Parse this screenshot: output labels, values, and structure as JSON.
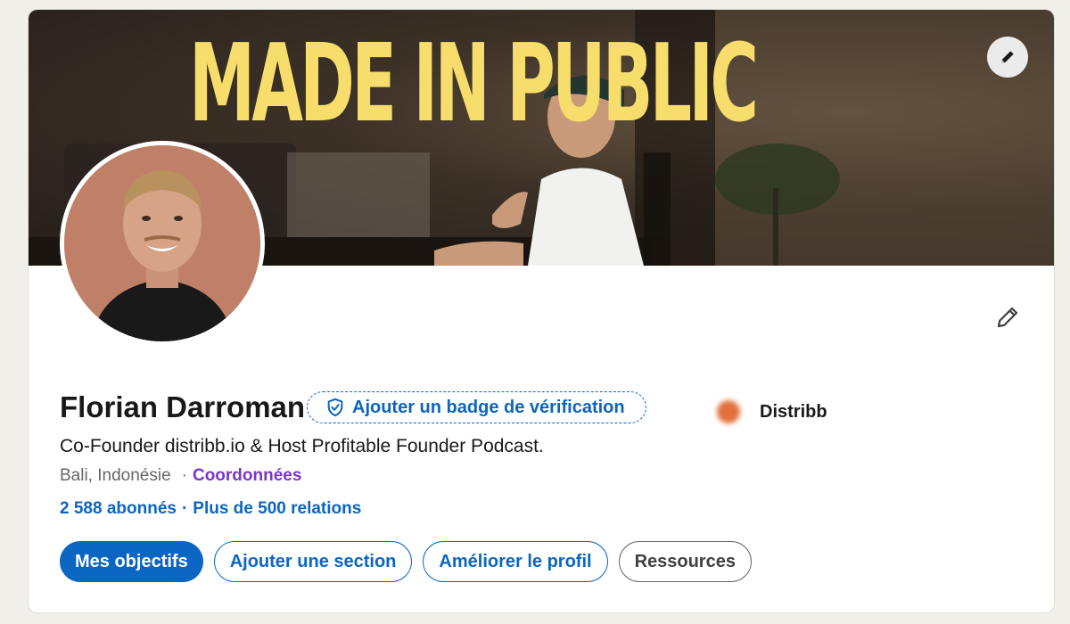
{
  "banner": {
    "title": "MADE IN PUBLIC"
  },
  "profile": {
    "name": "Florian Darroman",
    "verify_badge_label": "Ajouter un badge de vérification",
    "company": "Distribb",
    "headline": "Co-Founder distribb.io & Host Profitable Founder Podcast.",
    "location": "Bali, Indonésie",
    "contact_label": "Coordonnées",
    "followers": "2 588 abonnés",
    "connections": "Plus de 500 relations"
  },
  "actions": {
    "goals": "Mes objectifs",
    "add_section": "Ajouter une section",
    "improve_profile": "Améliorer le profil",
    "resources": "Ressources"
  },
  "colors": {
    "accent": "#0a66c2",
    "banner_text": "#f7de6c",
    "contact_link": "#7a36c9",
    "company_logo": "#e36f3c"
  },
  "icons": {
    "banner_edit": "pencil-icon",
    "profile_edit": "pencil-icon",
    "verify": "shield-check-icon"
  }
}
